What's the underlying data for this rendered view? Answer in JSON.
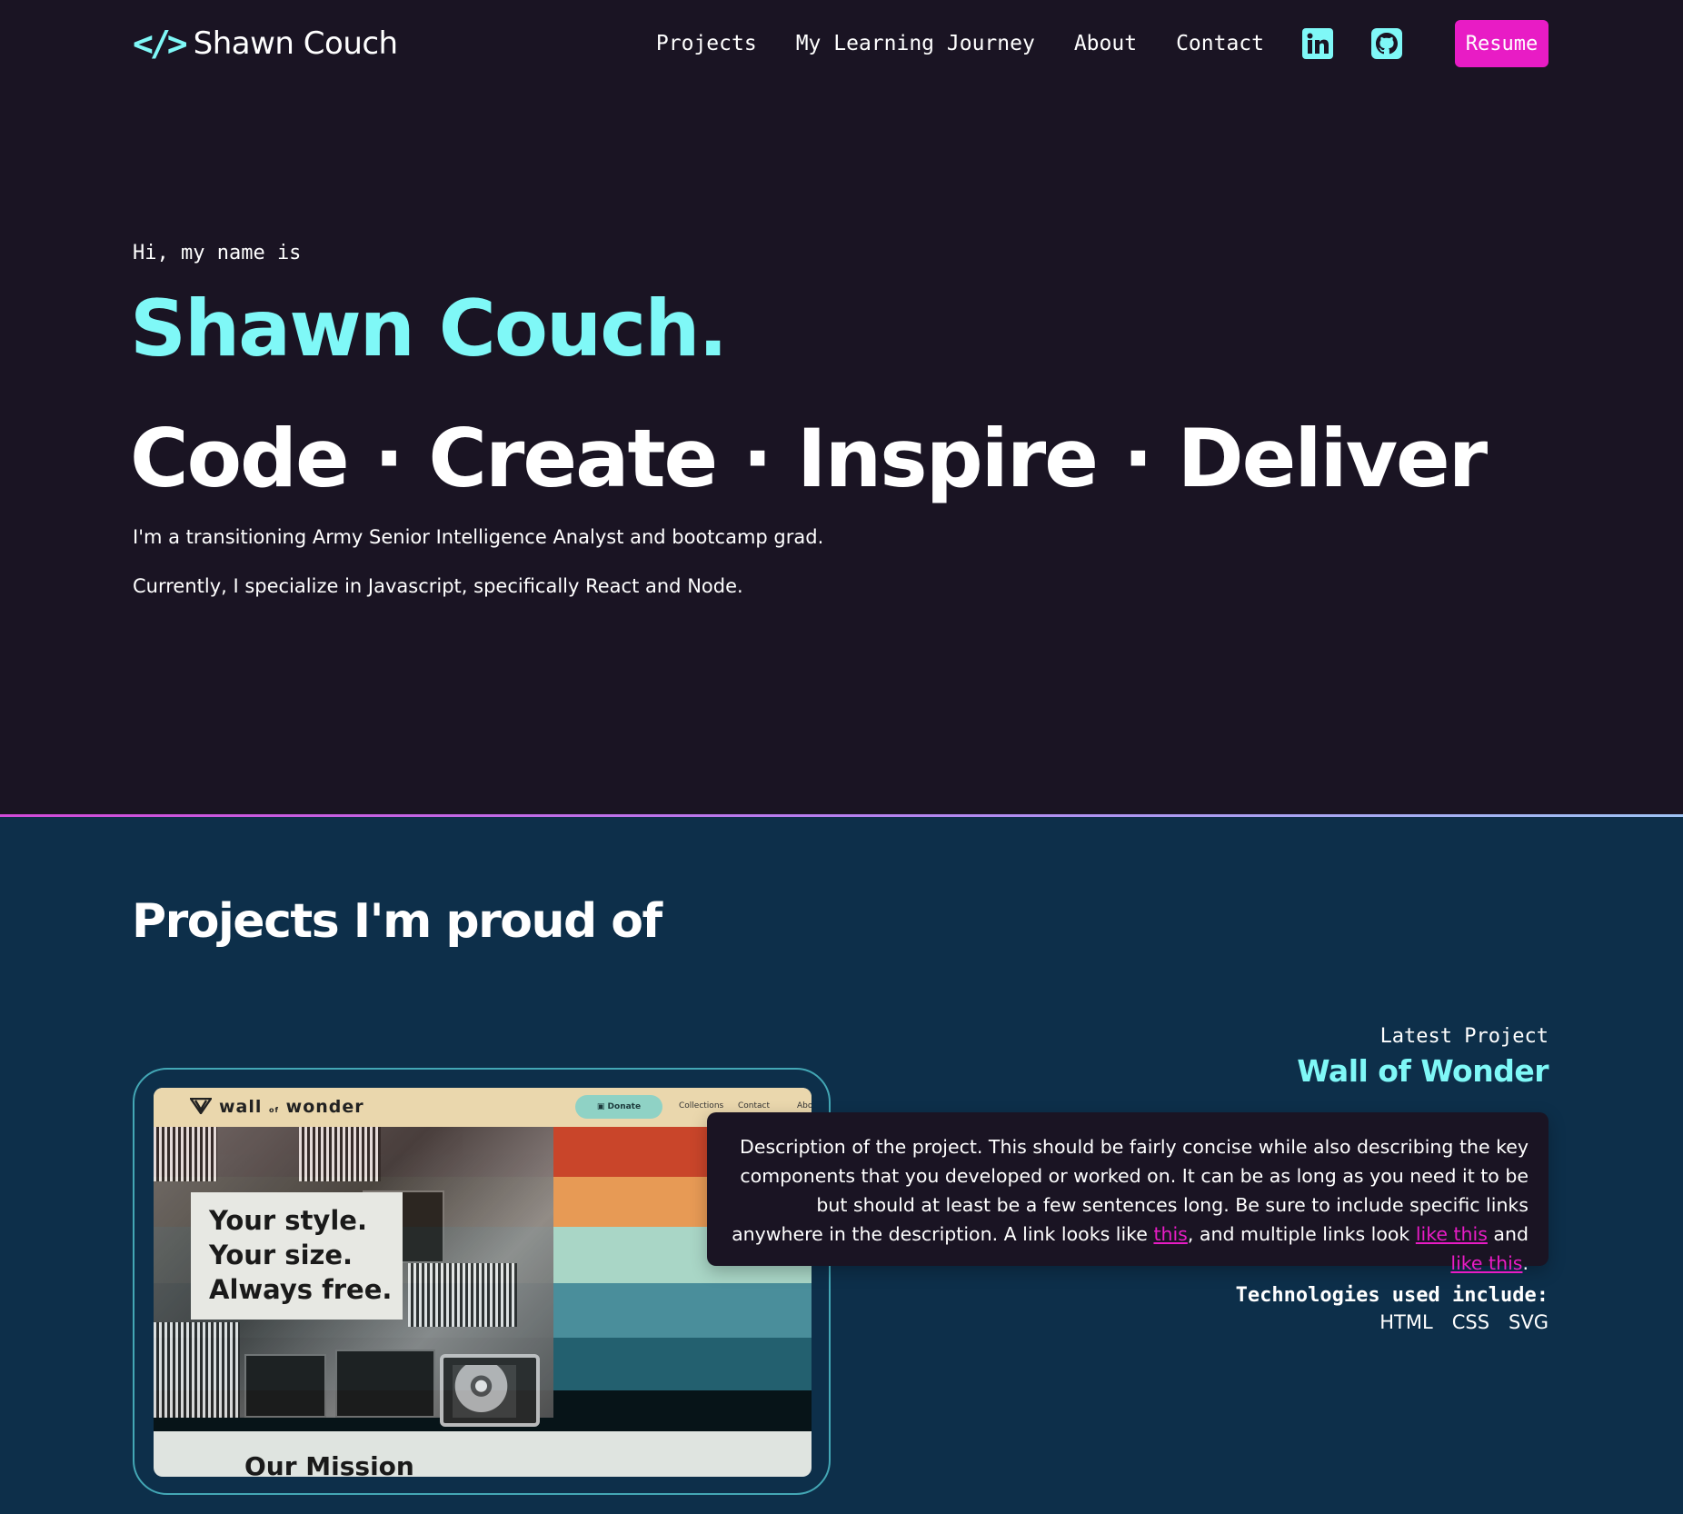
{
  "brand": {
    "icon": "</>",
    "name": "Shawn Couch"
  },
  "nav": {
    "links": [
      "Projects",
      "My Learning Journey",
      "About",
      "Contact"
    ],
    "linkedin_icon": "linkedin-icon",
    "github_icon": "github-icon",
    "resume_label": "Resume"
  },
  "hero": {
    "greeting": "Hi, my name is",
    "name": "Shawn Couch.",
    "tagline": "Code · Create · Inspire · Deliver",
    "intro_1": "I'm a transitioning Army Senior Intelligence Analyst and bootcamp grad.",
    "intro_2": "Currently, I specialize in Javascript, specifically React and Node."
  },
  "projects": {
    "heading": "Projects I'm proud of",
    "latest": {
      "label": "Latest Project",
      "title": "Wall of Wonder",
      "description_before": "Description of the project. This should be fairly concise while also describing the key components that you developed or worked on. It can be as long as you need it to be but should at least be a few sentences long. Be sure to include specific links anywhere in the description. A link looks like ",
      "link_1": "this",
      "description_mid": ", and multiple links look ",
      "link_2": "like this",
      "description_and": " and ",
      "link_3": "like this",
      "description_end": ".",
      "tech_label": "Technologies used include:",
      "technologies": [
        "HTML",
        "CSS",
        "SVG"
      ],
      "screenshot": {
        "logo_small": "wall",
        "logo_of": "of",
        "logo_big": "wonder",
        "donate": "Donate",
        "nav_1": "Collections",
        "nav_2": "Contact",
        "nav_3": "Abo",
        "slogan_1": "Your style.",
        "slogan_2": "Your size.",
        "slogan_3": "Always free.",
        "section_heading": "Our Mission"
      }
    }
  },
  "colors": {
    "hero_bg": "#1a1423",
    "projects_bg": "#0d2f4a",
    "accent_cyan": "#7ff8f7",
    "accent_magenta": "#e81cc5"
  }
}
